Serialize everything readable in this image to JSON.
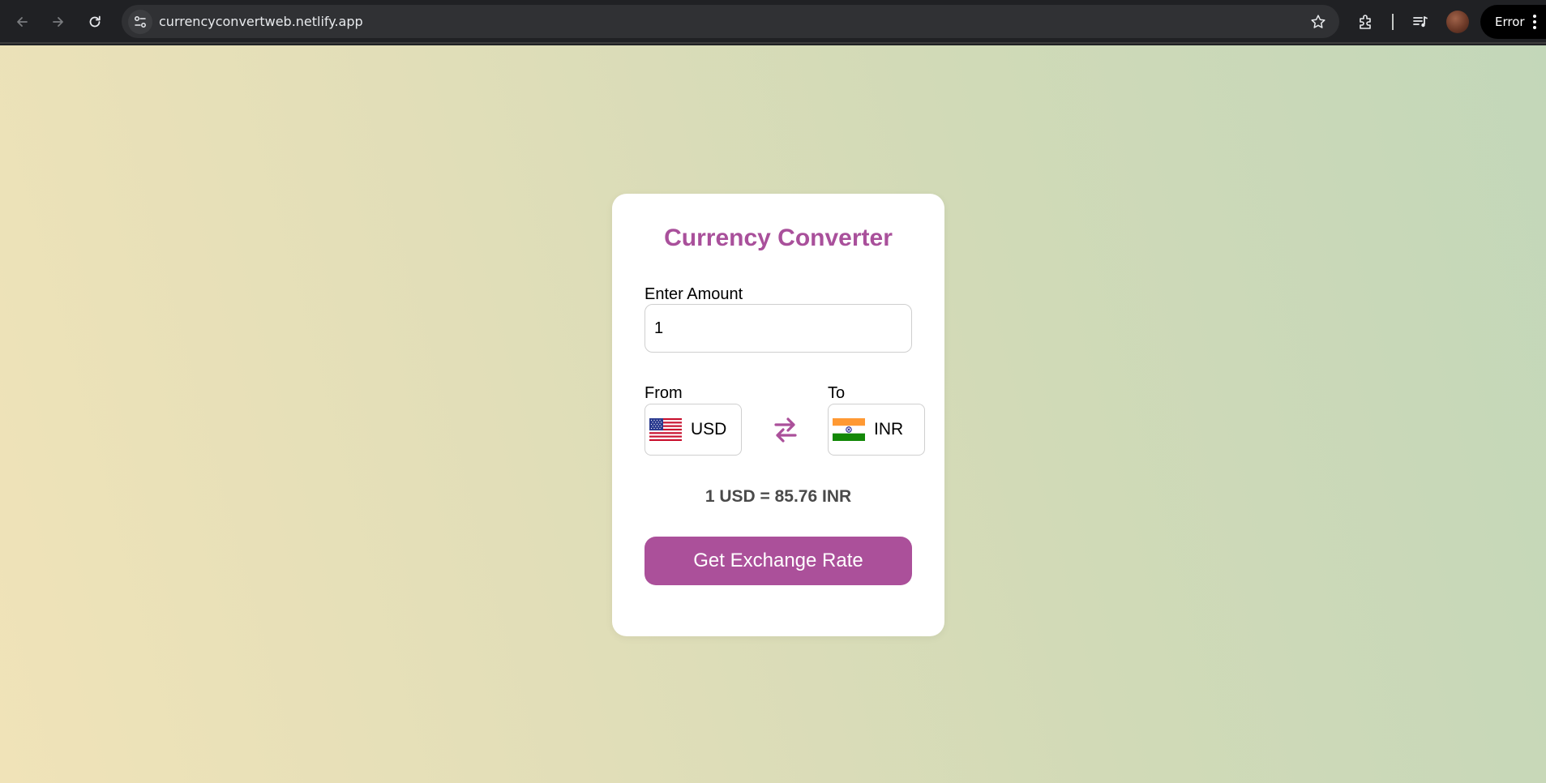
{
  "browser": {
    "url": "currencyconvertweb.netlify.app",
    "error_label": "Error"
  },
  "converter": {
    "title": "Currency Converter",
    "amount_label": "Enter Amount",
    "amount_value": "1",
    "from_label": "From",
    "to_label": "To",
    "from_currency": "USD",
    "to_currency": "INR",
    "rate_text": "1 USD = 85.76 INR",
    "button_label": "Get Exchange Rate"
  },
  "colors": {
    "accent": "#ab509a",
    "title": "#a9509b",
    "card_bg": "#ffffff",
    "rate_text": "#4a4a4a"
  },
  "icons": [
    "back-arrow-icon",
    "forward-arrow-icon",
    "reload-icon",
    "site-info-icon",
    "bookmark-star-icon",
    "extensions-icon",
    "media-controls-icon",
    "profile-avatar",
    "more-menu-icon",
    "us-flag-icon",
    "india-flag-icon",
    "swap-arrows-icon"
  ]
}
